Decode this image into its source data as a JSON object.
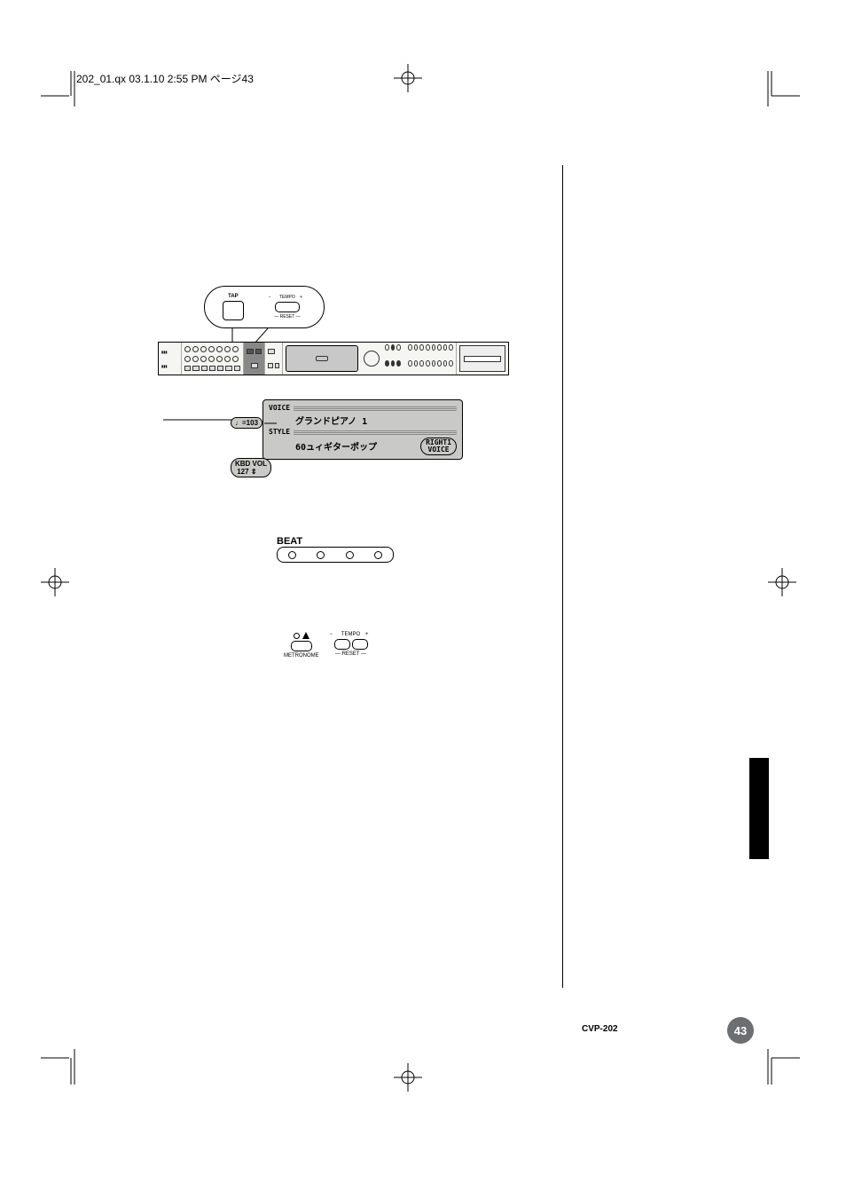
{
  "header": {
    "file_line": "202_01.qx  03.1.10  2:55 PM  ページ43"
  },
  "footer": {
    "model": "CVP-202",
    "page_number": "43"
  },
  "tap_tempo_panel": {
    "tap_label": "TAP",
    "tempo_label": "TEMPO",
    "minus": "−",
    "plus": "+",
    "reset_label": "RESET"
  },
  "lcd": {
    "voice_label": "VOICE",
    "voice_value": "グランドピアノ 1",
    "style_label": "STYLE",
    "style_value": "60ュィギターポップ",
    "right1_label": "RIGHT1",
    "voice_sub_label": "VOICE",
    "tempo_icon": "♩=",
    "tempo_value": "103",
    "kbd_vol_label": "KBD VOL",
    "kbd_vol_value": "127"
  },
  "beat": {
    "label": "BEAT",
    "leds": 4
  },
  "metronome": {
    "label": "METRONOME",
    "tempo_label": "TEMPO",
    "minus": "−",
    "plus": "+",
    "reset_label": "RESET"
  }
}
